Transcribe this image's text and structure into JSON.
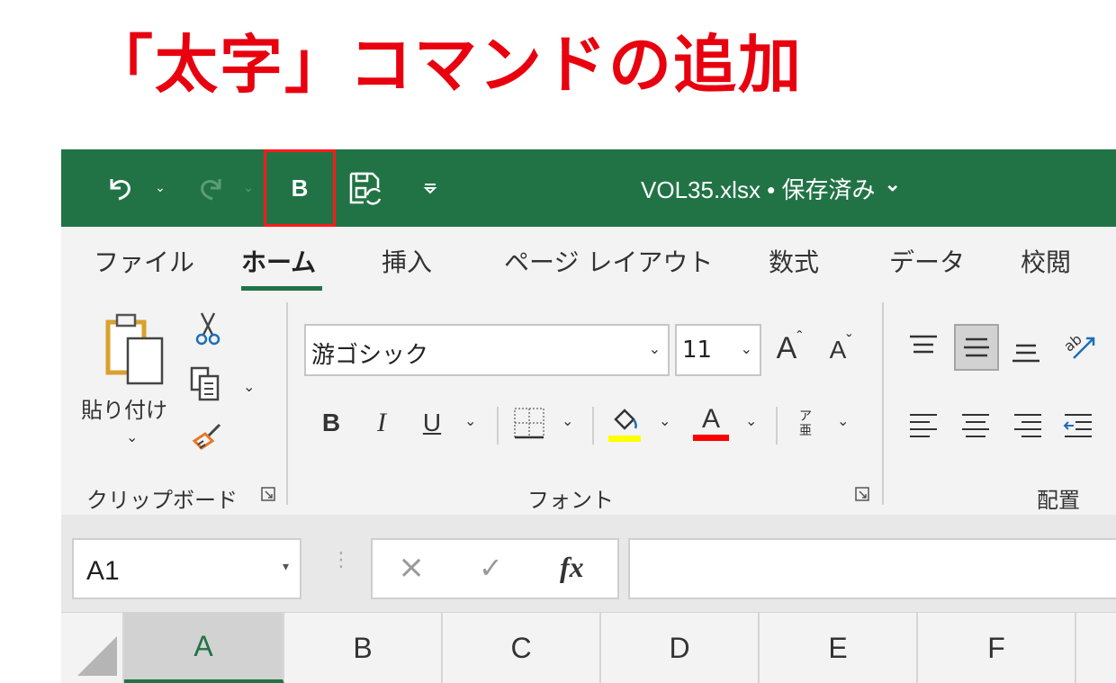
{
  "heading": "「太字」コマンドの追加",
  "title_bar": {
    "bold_button_label": "B",
    "filename": "VOL35.xlsx • 保存済み",
    "filename_chevron": "⌄"
  },
  "tabs": [
    "ファイル",
    "ホーム",
    "挿入",
    "ページ レイアウト",
    "数式",
    "データ",
    "校閲"
  ],
  "active_tab": "ホーム",
  "clipboard": {
    "paste_label": "貼り付け",
    "group_label": "クリップボード"
  },
  "font": {
    "font_name": "游ゴシック",
    "font_size": "11",
    "grow_label": "A",
    "shrink_label": "A",
    "bold": "B",
    "italic": "I",
    "underline": "U",
    "font_color_letter": "A",
    "phonetic_top": "ア",
    "phonetic_bottom": "亜",
    "group_label": "フォント",
    "highlight_color": "#ffff00",
    "font_color": "#ff0000"
  },
  "alignment": {
    "group_label": "配置"
  },
  "formula_bar": {
    "name_box": "A1",
    "cancel": "×",
    "enter": "✓",
    "fx": "fx"
  },
  "columns": [
    "A",
    "B",
    "C",
    "D",
    "E",
    "F"
  ],
  "accent_color": "#217346",
  "highlight_border_color": "#ff1a1a"
}
